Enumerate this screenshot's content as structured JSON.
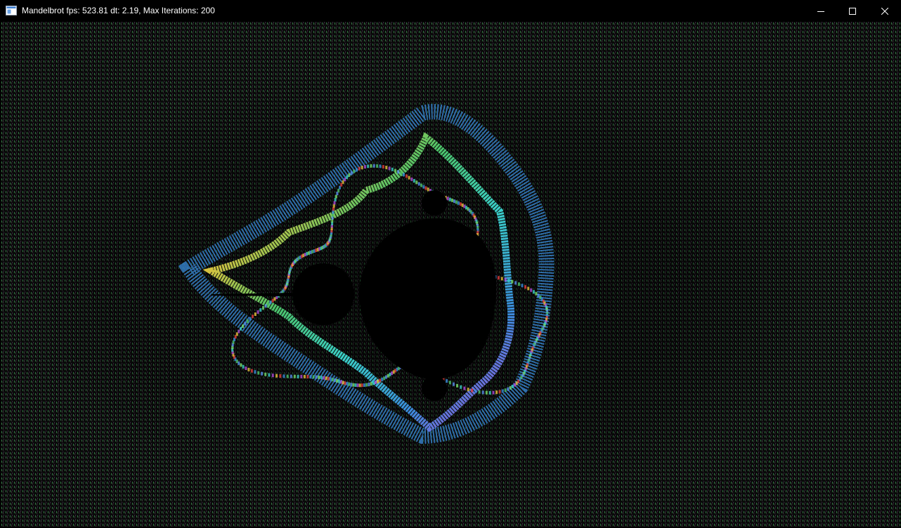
{
  "window": {
    "title": "Mandelbrot fps: 523.81 dt: 2.19, Max Iterations: 200",
    "icon": "app-window-icon",
    "controls": {
      "minimize": "minimize-icon",
      "maximize": "maximize-icon",
      "close": "close-icon"
    }
  },
  "render": {
    "fractal": "mandelbrot",
    "max_iterations": 200,
    "background": "#050505",
    "set_color": "#000000",
    "palette": [
      "#4cc46a",
      "#3a8cdc",
      "#e03c3c",
      "#e8c23a",
      "#b04ad8",
      "#3ad0c8",
      "#78e06a",
      "#5a8ef0"
    ]
  }
}
